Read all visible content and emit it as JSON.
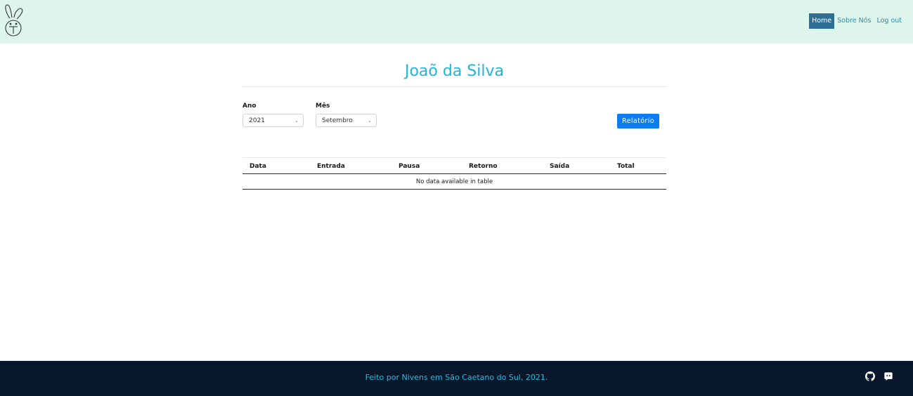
{
  "nav": {
    "home_label": "Home",
    "about_label": "Sobre Nós",
    "logout_label": "Log out"
  },
  "page": {
    "title": "Joaõ da Silva"
  },
  "filters": {
    "year_label": "Ano",
    "year_value": "2021",
    "month_label": "Mês",
    "month_value": "Setembro",
    "report_button_label": "Relatório"
  },
  "table": {
    "columns": [
      "Data",
      "Entrada",
      "Pausa",
      "Retorno",
      "Saída",
      "Total"
    ],
    "empty_message": "No data available in table"
  },
  "footer": {
    "text": "Feito por Nivens em São Caetano do Sul, 2021.",
    "icons": [
      "github-icon",
      "discord-icon"
    ]
  },
  "colors": {
    "navbar_bg": "#ddf5ea",
    "accent": "#1fb5d6",
    "active_nav": "#2f6f96",
    "button": "#0d7df5",
    "footer_bg": "#081729"
  }
}
